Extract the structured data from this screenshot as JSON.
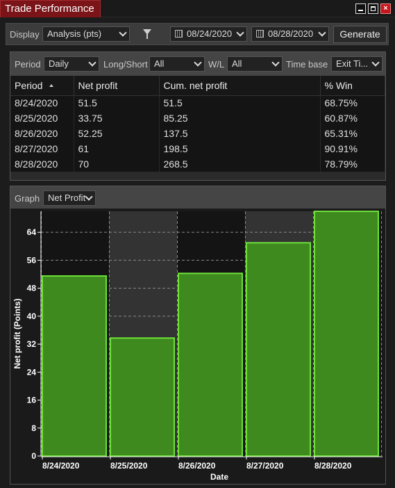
{
  "window": {
    "title": "Trade Performance"
  },
  "toolbar": {
    "display_label": "Display",
    "display_value": "Analysis (pts)",
    "start_date": "08/24/2020",
    "end_date": "08/28/2020",
    "generate_label": "Generate"
  },
  "filters": {
    "period_label": "Period",
    "period_value": "Daily",
    "longshort_label": "Long/Short",
    "longshort_value": "All",
    "wl_label": "W/L",
    "wl_value": "All",
    "timebase_label": "Time base",
    "timebase_value": "Exit Ti..."
  },
  "table": {
    "columns": [
      "Period",
      "Net profit",
      "Cum. net profit",
      "% Win"
    ],
    "rows": [
      [
        "8/24/2020",
        "51.5",
        "51.5",
        "68.75%"
      ],
      [
        "8/25/2020",
        "33.75",
        "85.25",
        "60.87%"
      ],
      [
        "8/26/2020",
        "52.25",
        "137.5",
        "65.31%"
      ],
      [
        "8/27/2020",
        "61",
        "198.5",
        "90.91%"
      ],
      [
        "8/28/2020",
        "70",
        "268.5",
        "78.79%"
      ]
    ]
  },
  "graph": {
    "label": "Graph",
    "select_value": "Net Profit"
  },
  "chart_data": {
    "type": "bar",
    "categories": [
      "8/24/2020",
      "8/25/2020",
      "8/26/2020",
      "8/27/2020",
      "8/28/2020"
    ],
    "values": [
      51.5,
      33.75,
      52.25,
      61,
      70
    ],
    "xlabel": "Date",
    "ylabel": "Net profit (Points)",
    "ylim": [
      0,
      70
    ],
    "yticks": [
      0,
      8,
      16,
      24,
      32,
      40,
      48,
      56,
      64
    ],
    "grid": true,
    "bar_color": "#3f8a1f",
    "bar_edge_color": "#6ee03a"
  }
}
